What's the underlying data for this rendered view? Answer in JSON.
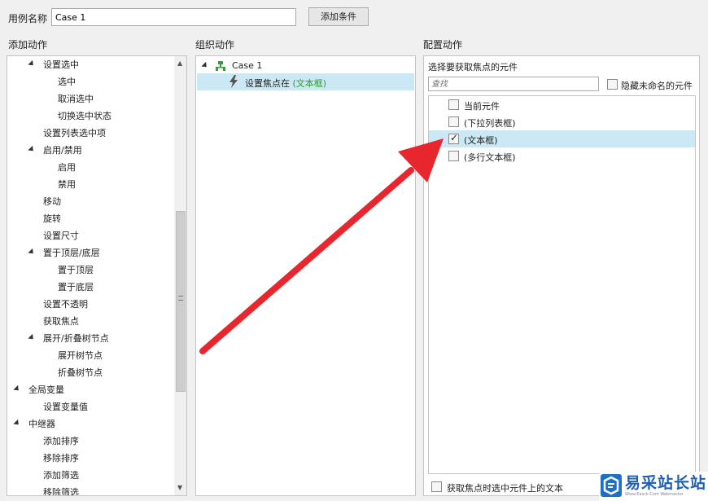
{
  "top": {
    "case_name_label": "用例名称",
    "case_name_value": "Case 1",
    "add_condition_label": "添加条件"
  },
  "add_actions": {
    "title": "添加动作",
    "items": [
      {
        "label": "设置选中",
        "level": 1,
        "expanded": true
      },
      {
        "label": "选中",
        "level": 2
      },
      {
        "label": "取消选中",
        "level": 2
      },
      {
        "label": "切换选中状态",
        "level": 2
      },
      {
        "label": "设置列表选中项",
        "level": 1
      },
      {
        "label": "启用/禁用",
        "level": 1,
        "expanded": true
      },
      {
        "label": "启用",
        "level": 2
      },
      {
        "label": "禁用",
        "level": 2
      },
      {
        "label": "移动",
        "level": 1
      },
      {
        "label": "旋转",
        "level": 1
      },
      {
        "label": "设置尺寸",
        "level": 1
      },
      {
        "label": "置于顶层/底层",
        "level": 1,
        "expanded": true
      },
      {
        "label": "置于顶层",
        "level": 2
      },
      {
        "label": "置于底层",
        "level": 2
      },
      {
        "label": "设置不透明",
        "level": 1
      },
      {
        "label": "获取焦点",
        "level": 1
      },
      {
        "label": "展开/折叠树节点",
        "level": 1,
        "expanded": true
      },
      {
        "label": "展开树节点",
        "level": 2
      },
      {
        "label": "折叠树节点",
        "level": 2
      },
      {
        "label": "全局变量",
        "level": 0,
        "expanded": true
      },
      {
        "label": "设置变量值",
        "level": 1
      },
      {
        "label": "中继器",
        "level": 0,
        "expanded": true
      },
      {
        "label": "添加排序",
        "level": 1
      },
      {
        "label": "移除排序",
        "level": 1
      },
      {
        "label": "添加筛选",
        "level": 1
      },
      {
        "label": "移除筛选",
        "level": 1
      }
    ]
  },
  "organize": {
    "title": "组织动作",
    "case_label": "Case 1",
    "action_prefix": "设置焦点在",
    "action_target": "(文本框)"
  },
  "configure": {
    "title": "配置动作",
    "subtitle": "选择要获取焦点的元件",
    "search_placeholder": "查找",
    "hide_unnamed_label": "隐藏未命名的元件",
    "widgets": [
      {
        "label": "当前元件",
        "checked": false
      },
      {
        "label": "(下拉列表框)",
        "checked": false
      },
      {
        "label": "(文本框)",
        "checked": true
      },
      {
        "label": "(多行文本框)",
        "checked": false
      }
    ],
    "select_text_label": "获取焦点时选中元件上的文本"
  },
  "watermark": {
    "title": "易采站长站",
    "subtitle": "Www.Easck.Com Webmaster"
  },
  "colors": {
    "arrow": "#e8262e",
    "selection": "#cde8f5",
    "accent_green": "#2e9a2e"
  }
}
